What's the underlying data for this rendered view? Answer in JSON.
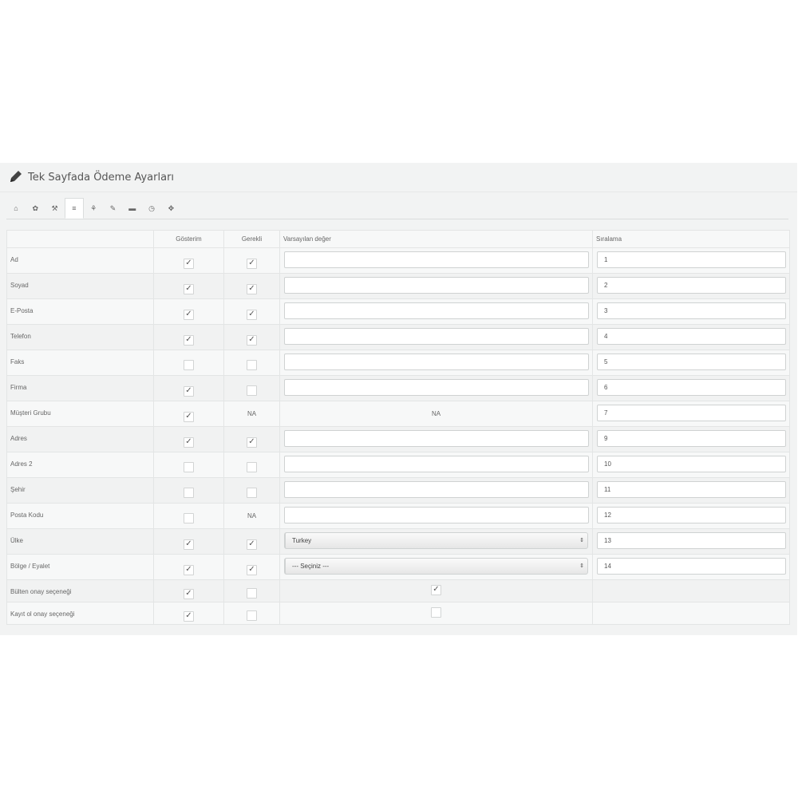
{
  "panel": {
    "title": "Tek Sayfada Ödeme Ayarları"
  },
  "tabs": [
    {
      "icon": "home-icon",
      "glyph": "⌂"
    },
    {
      "icon": "gear-icon",
      "glyph": "✿"
    },
    {
      "icon": "wrench-icon",
      "glyph": "⚒"
    },
    {
      "icon": "list-icon",
      "glyph": "≡",
      "active": true
    },
    {
      "icon": "sitemap-icon",
      "glyph": "⚘"
    },
    {
      "icon": "edit-icon",
      "glyph": "✎"
    },
    {
      "icon": "truck-icon",
      "glyph": "▬"
    },
    {
      "icon": "clock-icon",
      "glyph": "◷"
    },
    {
      "icon": "puzzle-icon",
      "glyph": "✥"
    }
  ],
  "table": {
    "headers": [
      "",
      "Gösterim",
      "Gerekli",
      "Varsayılan değer",
      "Sıralama"
    ],
    "rows": [
      {
        "label": "Ad",
        "show": true,
        "required": "checked",
        "default": {
          "type": "text",
          "value": ""
        },
        "order": "1"
      },
      {
        "label": "Soyad",
        "show": true,
        "required": "checked",
        "default": {
          "type": "text",
          "value": ""
        },
        "order": "2"
      },
      {
        "label": "E-Posta",
        "show": true,
        "required": "checked",
        "default": {
          "type": "text",
          "value": ""
        },
        "order": "3"
      },
      {
        "label": "Telefon",
        "show": true,
        "required": "checked",
        "default": {
          "type": "text",
          "value": ""
        },
        "order": "4"
      },
      {
        "label": "Faks",
        "show": false,
        "required": "unchecked",
        "default": {
          "type": "text",
          "value": ""
        },
        "order": "5"
      },
      {
        "label": "Firma",
        "show": true,
        "required": "unchecked",
        "default": {
          "type": "text",
          "value": ""
        },
        "order": "6"
      },
      {
        "label": "Müşteri Grubu",
        "show": true,
        "required": "NA",
        "default": {
          "type": "na",
          "value": "NA"
        },
        "order": "7"
      },
      {
        "label": "Adres",
        "show": true,
        "required": "checked",
        "default": {
          "type": "text",
          "value": ""
        },
        "order": "9"
      },
      {
        "label": "Adres 2",
        "show": false,
        "required": "unchecked",
        "default": {
          "type": "text",
          "value": ""
        },
        "order": "10"
      },
      {
        "label": "Şehir",
        "show": false,
        "required": "unchecked",
        "default": {
          "type": "text",
          "value": ""
        },
        "order": "11"
      },
      {
        "label": "Posta Kodu",
        "show": false,
        "required": "NA",
        "default": {
          "type": "text",
          "value": ""
        },
        "order": "12"
      },
      {
        "label": "Ülke",
        "show": true,
        "required": "checked",
        "default": {
          "type": "select",
          "value": "Turkey"
        },
        "order": "13"
      },
      {
        "label": "Bölge / Eyalet",
        "show": true,
        "required": "checked",
        "default": {
          "type": "select",
          "value": "--- Seçiniz ---"
        },
        "order": "14"
      },
      {
        "label": "Bülten onay seçeneği",
        "show": true,
        "required": "unchecked",
        "default": {
          "type": "checkbox",
          "checked": true
        },
        "order": null
      },
      {
        "label": "Kayıt ol onay seçeneği",
        "show": true,
        "required": "unchecked",
        "default": {
          "type": "checkbox",
          "checked": false
        },
        "order": null
      }
    ]
  }
}
